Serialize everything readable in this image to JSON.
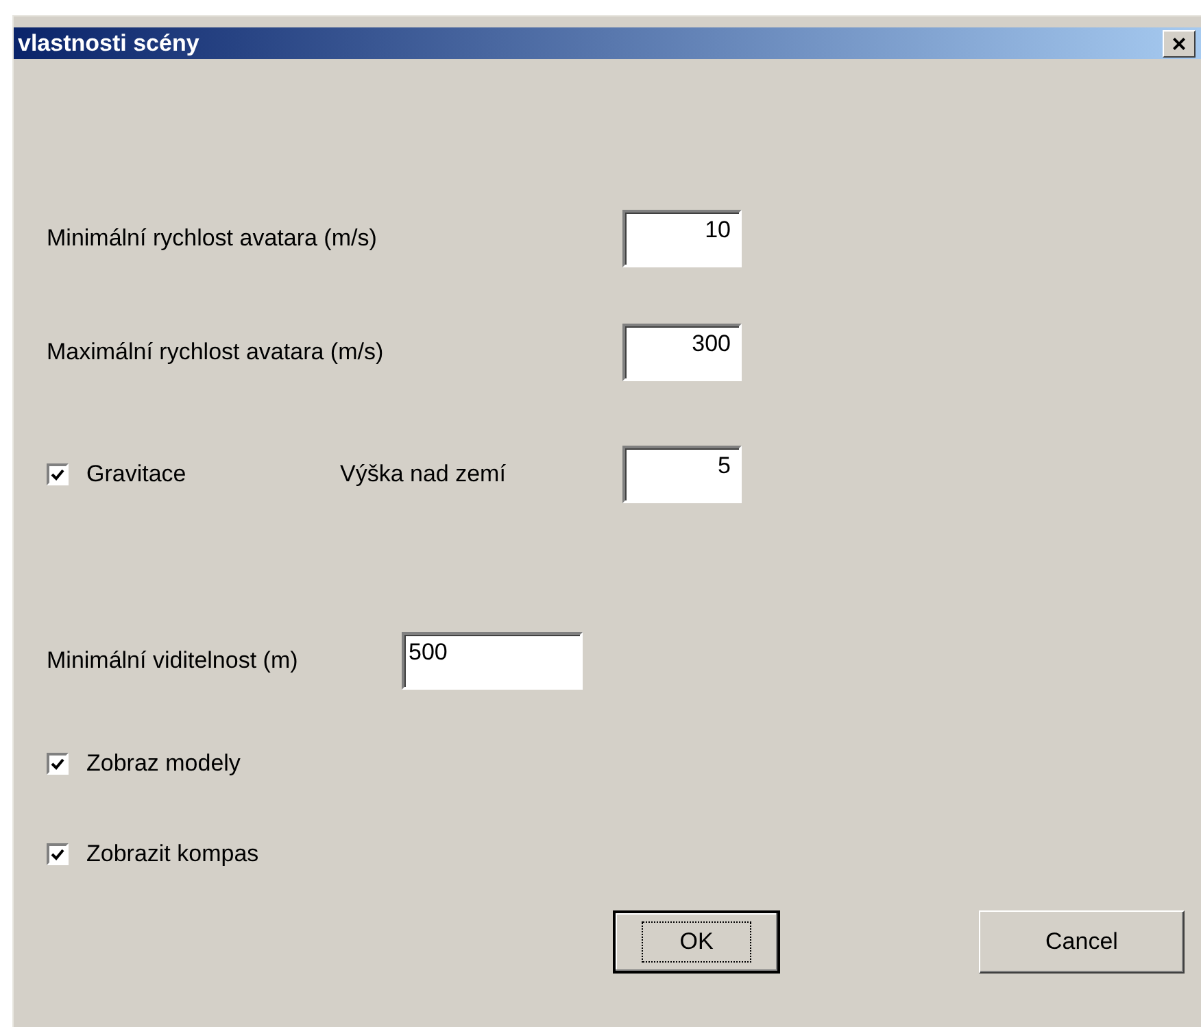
{
  "window": {
    "title": "vlastnosti scény",
    "close": "×"
  },
  "rows": [
    {
      "kind": "number",
      "label": "Minimální rychlost avatara (m/s)",
      "value": "10"
    },
    {
      "kind": "number",
      "label": "Maximální rychlost avatara (m/s)",
      "value": "300"
    },
    {
      "kind": "check-number",
      "check_label": "Gravitace",
      "checked": true,
      "label": "Výška nad zemí",
      "value": "5"
    },
    {
      "kind": "text",
      "label": "Minimální viditelnost (m)",
      "value": "500"
    },
    {
      "kind": "check",
      "label": "Zobraz modely",
      "checked": true
    },
    {
      "kind": "check",
      "label": "Zobrazit kompas",
      "checked": true
    }
  ],
  "buttons": [
    {
      "label": "OK",
      "default": true
    },
    {
      "label": "Cancel",
      "default": false
    }
  ]
}
